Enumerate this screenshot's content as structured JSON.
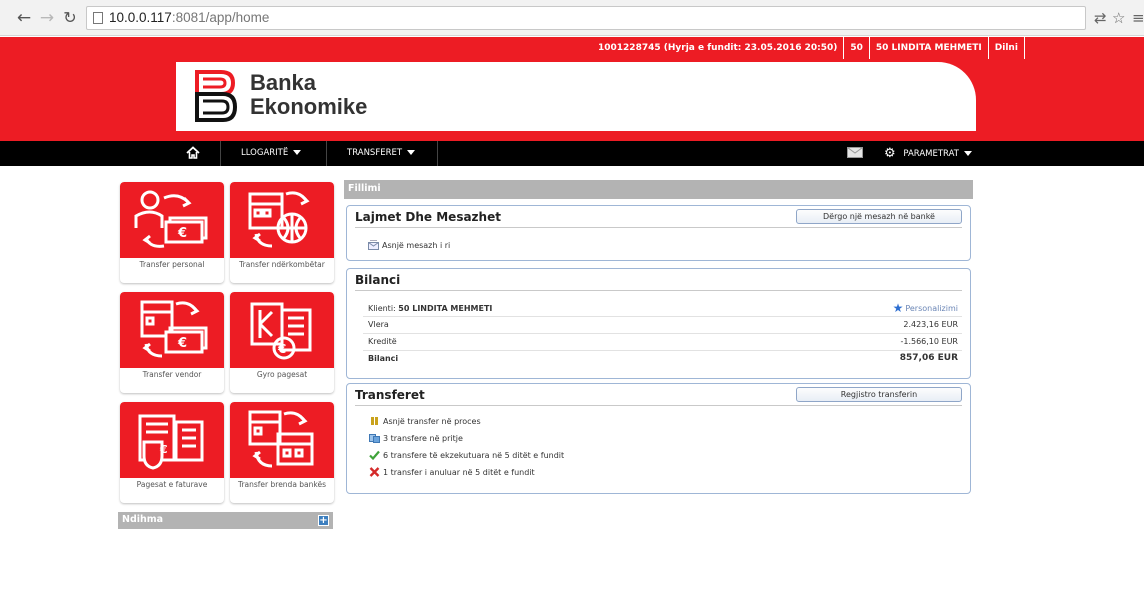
{
  "browser": {
    "url_host": "10.0.0.117",
    "url_rest": ":8081/app/home",
    "back_icon": "back-arrow-icon",
    "forward_icon": "forward-arrow-icon",
    "reload_icon": "reload-icon"
  },
  "header": {
    "account_info": "1001228745  (Hyrja e fundit: 23.05.2016 20:50)",
    "count": "50",
    "user": "50 LINDITA MEHMETI",
    "logout": "Dilni",
    "brand_line1": "Banka",
    "brand_line2": "Ekonomike",
    "brand_color": "#ed1c24"
  },
  "nav": {
    "home_icon": "home-icon",
    "accounts": "LLOGARITË",
    "transfers": "TRANSFERET",
    "settings": "PARAMETRAT"
  },
  "tiles": [
    {
      "label": "Transfer personal"
    },
    {
      "label": "Transfer ndërkombëtar"
    },
    {
      "label": "Transfer vendor"
    },
    {
      "label": "Gyro pagesat"
    },
    {
      "label": "Pagesat e faturave"
    },
    {
      "label": "Transfer brenda bankës"
    }
  ],
  "help": {
    "label": "Ndihma"
  },
  "main": {
    "title": "Fillimi",
    "news": {
      "title": "Lajmet Dhe Mesazhet",
      "button": "Dërgo një mesazh në bankë",
      "empty": "Asnjë mesazh i ri"
    },
    "balance": {
      "title": "Bilanci",
      "client_label": "Klienti:",
      "client_name": "50 LINDITA MEHMETI",
      "personalize": "Personalizimi",
      "rows": [
        {
          "label": "Vlera",
          "value": "2.423,16  EUR"
        },
        {
          "label": "Kreditë",
          "value": "-1.566,10 EUR"
        },
        {
          "label": "Bilanci",
          "value": "857,06 EUR"
        }
      ]
    },
    "transfers": {
      "title": "Transferet",
      "button": "Regjistro transferin",
      "items": [
        {
          "text": "Asnjë transfer në proces"
        },
        {
          "text": "3 transfere në pritje"
        },
        {
          "text": "6 transfere të ekzekutuara në 5 ditët e fundit"
        },
        {
          "text": "1 transfer i anuluar në 5 ditët e fundit"
        }
      ]
    }
  }
}
